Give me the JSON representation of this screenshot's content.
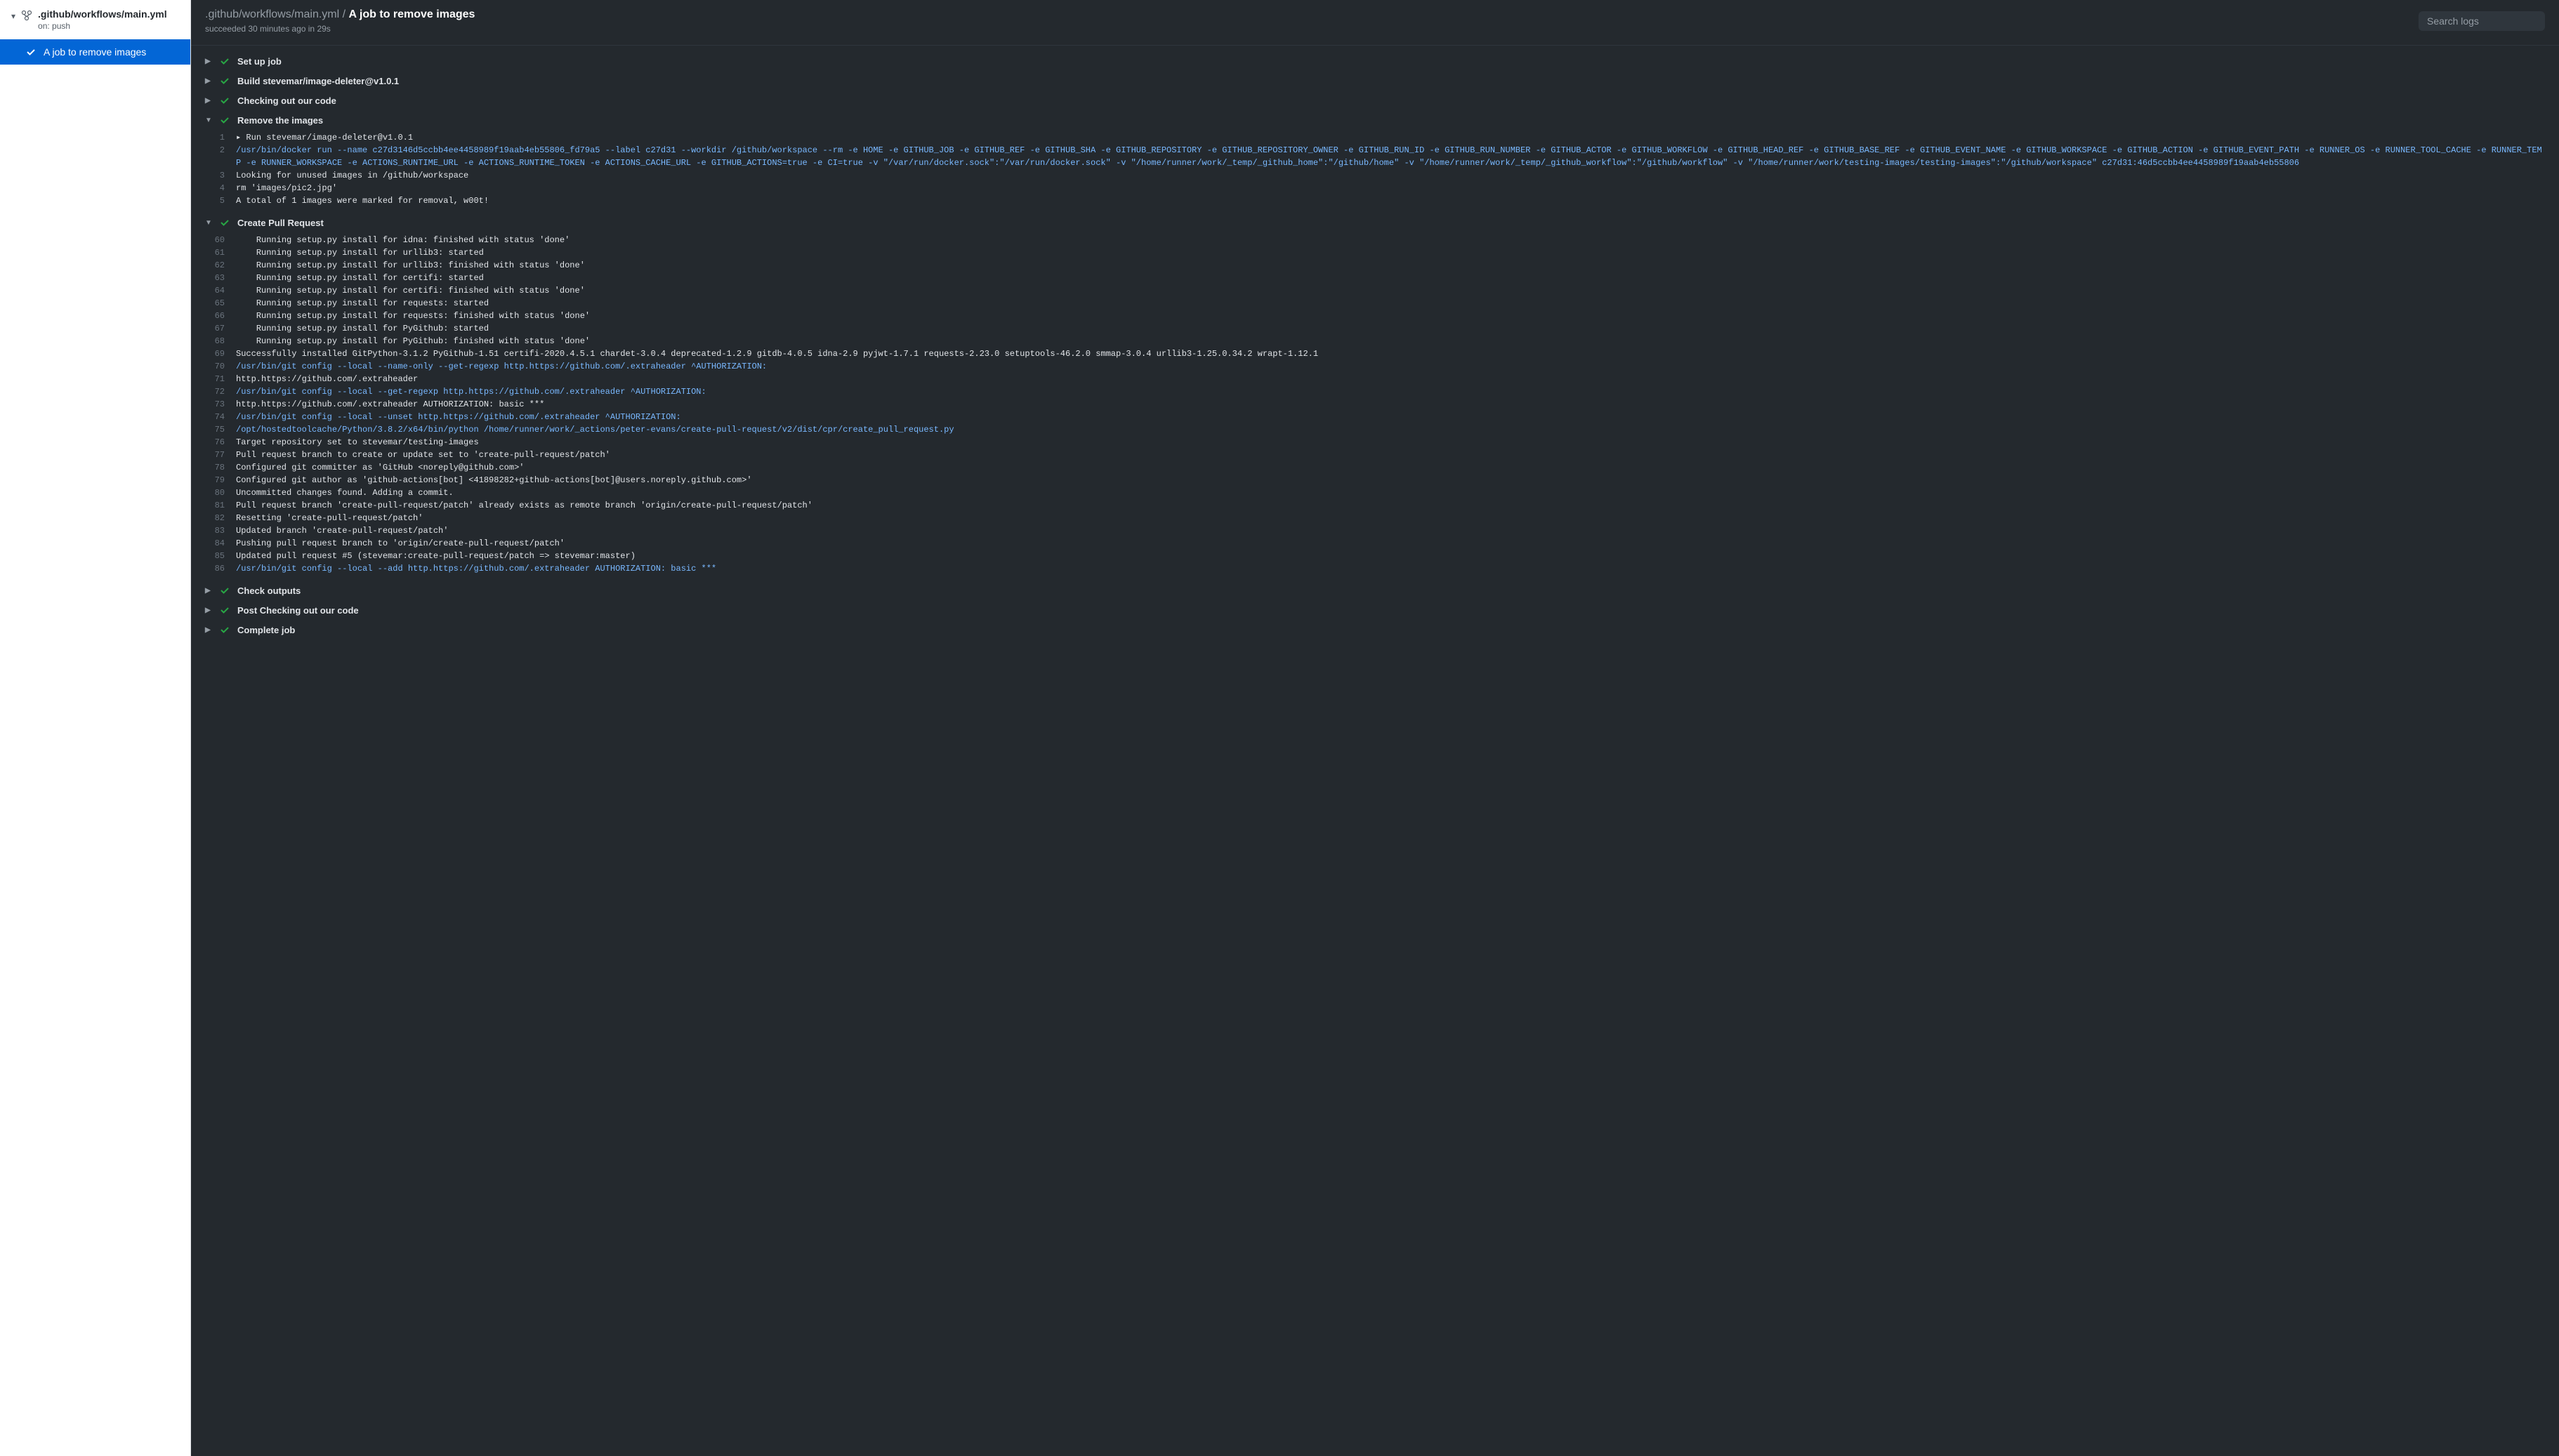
{
  "sidebar": {
    "workflow_file": ".github/workflows/main.yml",
    "trigger": "on: push",
    "job_name": "A job to remove images"
  },
  "header": {
    "crumb_path": ".github/workflows/main.yml",
    "crumb_sep": " / ",
    "crumb_current": "A job to remove images",
    "status_line": "succeeded 30 minutes ago in 29s",
    "search_placeholder": "Search logs"
  },
  "steps": [
    {
      "name": "Set up job",
      "expanded": false
    },
    {
      "name": "Build stevemar/image-deleter@v1.0.1",
      "expanded": false
    },
    {
      "name": "Checking out our code",
      "expanded": false
    },
    {
      "name": "Remove the images",
      "expanded": true,
      "lines": [
        {
          "n": "1",
          "t": "▸ Run stevemar/image-deleter@v1.0.1",
          "c": ""
        },
        {
          "n": "2",
          "t": "/usr/bin/docker run --name c27d3146d5ccbb4ee4458989f19aab4eb55806_fd79a5 --label c27d31 --workdir /github/workspace --rm -e HOME -e GITHUB_JOB -e GITHUB_REF -e GITHUB_SHA -e GITHUB_REPOSITORY -e GITHUB_REPOSITORY_OWNER -e GITHUB_RUN_ID -e GITHUB_RUN_NUMBER -e GITHUB_ACTOR -e GITHUB_WORKFLOW -e GITHUB_HEAD_REF -e GITHUB_BASE_REF -e GITHUB_EVENT_NAME -e GITHUB_WORKSPACE -e GITHUB_ACTION -e GITHUB_EVENT_PATH -e RUNNER_OS -e RUNNER_TOOL_CACHE -e RUNNER_TEMP -e RUNNER_WORKSPACE -e ACTIONS_RUNTIME_URL -e ACTIONS_RUNTIME_TOKEN -e ACTIONS_CACHE_URL -e GITHUB_ACTIONS=true -e CI=true -v \"/var/run/docker.sock\":\"/var/run/docker.sock\" -v \"/home/runner/work/_temp/_github_home\":\"/github/home\" -v \"/home/runner/work/_temp/_github_workflow\":\"/github/workflow\" -v \"/home/runner/work/testing-images/testing-images\":\"/github/workspace\" c27d31:46d5ccbb4ee4458989f19aab4eb55806",
          "c": "blue"
        },
        {
          "n": "3",
          "t": "Looking for unused images in /github/workspace",
          "c": ""
        },
        {
          "n": "4",
          "t": "rm 'images/pic2.jpg'",
          "c": ""
        },
        {
          "n": "5",
          "t": "A total of 1 images were marked for removal, w00t!",
          "c": ""
        }
      ]
    },
    {
      "name": "Create Pull Request",
      "expanded": true,
      "lines": [
        {
          "n": "60",
          "t": "    Running setup.py install for idna: finished with status 'done'",
          "c": ""
        },
        {
          "n": "61",
          "t": "    Running setup.py install for urllib3: started",
          "c": ""
        },
        {
          "n": "62",
          "t": "    Running setup.py install for urllib3: finished with status 'done'",
          "c": ""
        },
        {
          "n": "63",
          "t": "    Running setup.py install for certifi: started",
          "c": ""
        },
        {
          "n": "64",
          "t": "    Running setup.py install for certifi: finished with status 'done'",
          "c": ""
        },
        {
          "n": "65",
          "t": "    Running setup.py install for requests: started",
          "c": ""
        },
        {
          "n": "66",
          "t": "    Running setup.py install for requests: finished with status 'done'",
          "c": ""
        },
        {
          "n": "67",
          "t": "    Running setup.py install for PyGithub: started",
          "c": ""
        },
        {
          "n": "68",
          "t": "    Running setup.py install for PyGithub: finished with status 'done'",
          "c": ""
        },
        {
          "n": "69",
          "t": "Successfully installed GitPython-3.1.2 PyGithub-1.51 certifi-2020.4.5.1 chardet-3.0.4 deprecated-1.2.9 gitdb-4.0.5 idna-2.9 pyjwt-1.7.1 requests-2.23.0 setuptools-46.2.0 smmap-3.0.4 urllib3-1.25.0.34.2 wrapt-1.12.1",
          "c": ""
        },
        {
          "n": "70",
          "t": "/usr/bin/git config --local --name-only --get-regexp http.https://github.com/.extraheader ^AUTHORIZATION:",
          "c": "blue"
        },
        {
          "n": "71",
          "t": "http.https://github.com/.extraheader",
          "c": ""
        },
        {
          "n": "72",
          "t": "/usr/bin/git config --local --get-regexp http.https://github.com/.extraheader ^AUTHORIZATION:",
          "c": "blue"
        },
        {
          "n": "73",
          "t": "http.https://github.com/.extraheader AUTHORIZATION: basic ***",
          "c": ""
        },
        {
          "n": "74",
          "t": "/usr/bin/git config --local --unset http.https://github.com/.extraheader ^AUTHORIZATION:",
          "c": "blue"
        },
        {
          "n": "75",
          "t": "/opt/hostedtoolcache/Python/3.8.2/x64/bin/python /home/runner/work/_actions/peter-evans/create-pull-request/v2/dist/cpr/create_pull_request.py",
          "c": "blue"
        },
        {
          "n": "76",
          "t": "Target repository set to stevemar/testing-images",
          "c": ""
        },
        {
          "n": "77",
          "t": "Pull request branch to create or update set to 'create-pull-request/patch'",
          "c": ""
        },
        {
          "n": "78",
          "t": "Configured git committer as 'GitHub <noreply@github.com>'",
          "c": ""
        },
        {
          "n": "79",
          "t": "Configured git author as 'github-actions[bot] <41898282+github-actions[bot]@users.noreply.github.com>'",
          "c": ""
        },
        {
          "n": "80",
          "t": "Uncommitted changes found. Adding a commit.",
          "c": ""
        },
        {
          "n": "81",
          "t": "Pull request branch 'create-pull-request/patch' already exists as remote branch 'origin/create-pull-request/patch'",
          "c": ""
        },
        {
          "n": "82",
          "t": "Resetting 'create-pull-request/patch'",
          "c": ""
        },
        {
          "n": "83",
          "t": "Updated branch 'create-pull-request/patch'",
          "c": ""
        },
        {
          "n": "84",
          "t": "Pushing pull request branch to 'origin/create-pull-request/patch'",
          "c": ""
        },
        {
          "n": "85",
          "t": "Updated pull request #5 (stevemar:create-pull-request/patch => stevemar:master)",
          "c": ""
        },
        {
          "n": "86",
          "t": "/usr/bin/git config --local --add http.https://github.com/.extraheader AUTHORIZATION: basic ***",
          "c": "blue"
        }
      ]
    },
    {
      "name": "Check outputs",
      "expanded": false
    },
    {
      "name": "Post Checking out our code",
      "expanded": false
    },
    {
      "name": "Complete job",
      "expanded": false
    }
  ]
}
